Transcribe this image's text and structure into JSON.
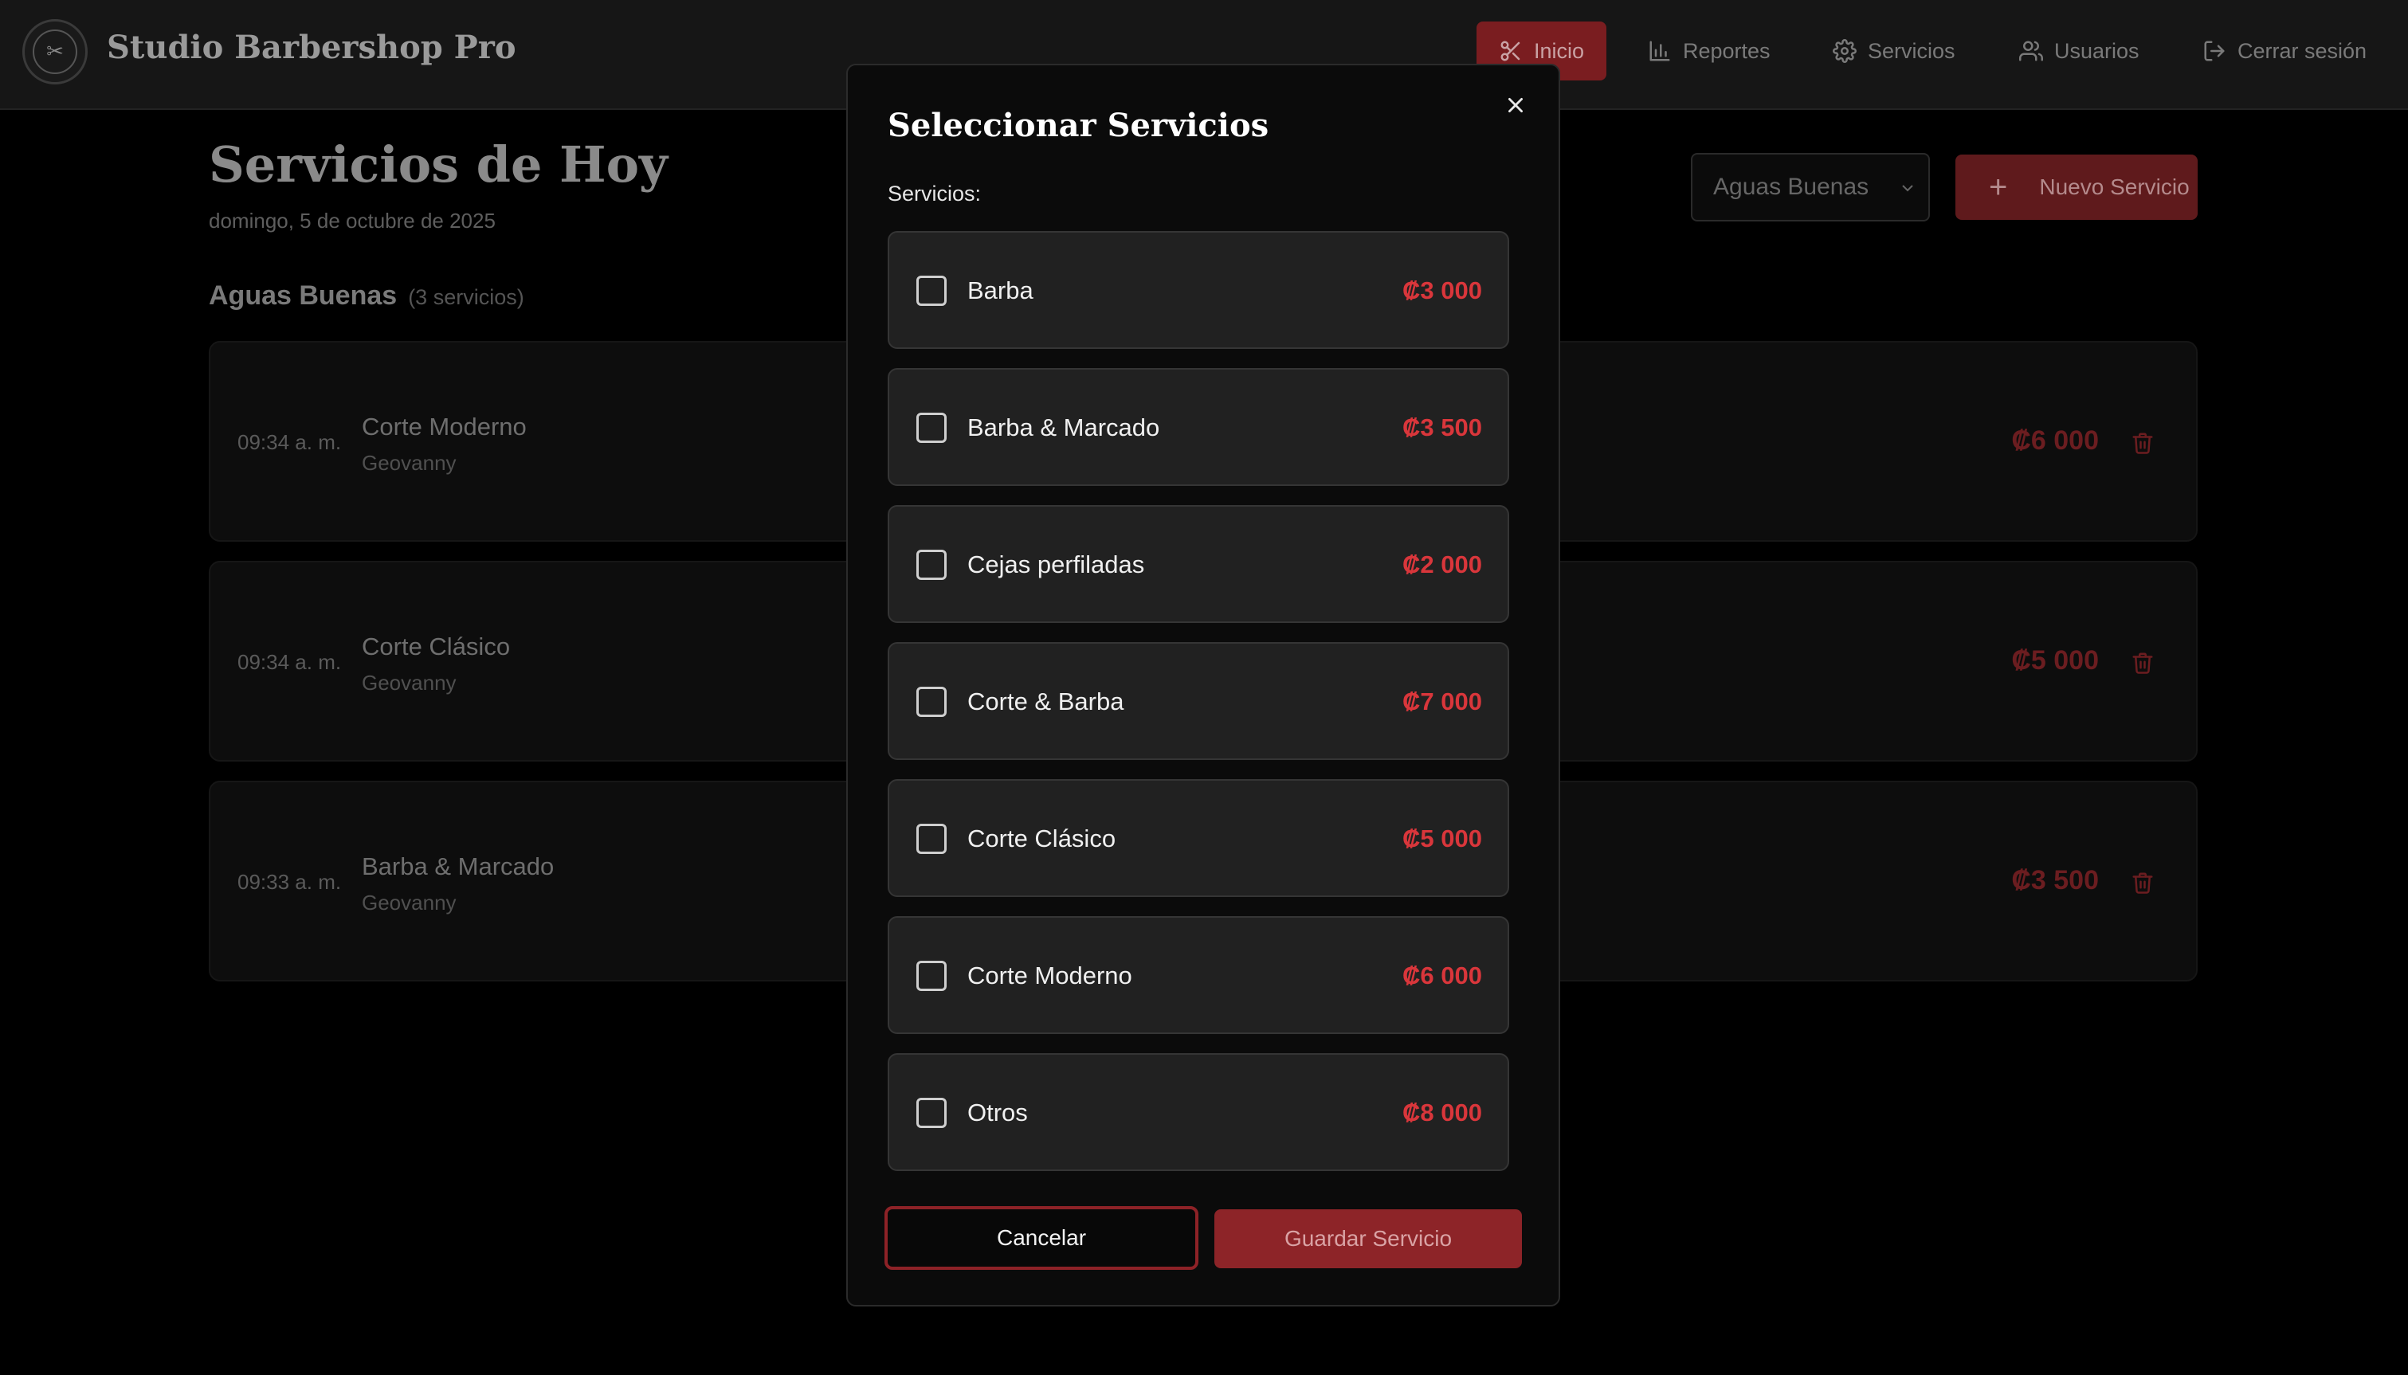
{
  "header": {
    "brand": "Studio Barbershop Pro",
    "nav": [
      {
        "label": "Inicio",
        "icon": "scissors-icon",
        "active": true
      },
      {
        "label": "Reportes",
        "icon": "bar-chart-icon"
      },
      {
        "label": "Servicios",
        "icon": "gear-icon"
      },
      {
        "label": "Usuarios",
        "icon": "users-icon"
      },
      {
        "label": "Cerrar sesión",
        "icon": "logout-icon"
      }
    ]
  },
  "main": {
    "title": "Servicios de Hoy",
    "date": "domingo, 5 de octubre de 2025",
    "branch_selected": "Aguas Buenas",
    "new_button": "Nuevo Servicio",
    "section_title": "Aguas Buenas",
    "section_count": "(3 servicios)",
    "services": [
      {
        "time": "09:34 a. m.",
        "name": "Corte Moderno",
        "barber": "Geovanny",
        "price": "₡6 000"
      },
      {
        "time": "09:34 a. m.",
        "name": "Corte Clásico",
        "barber": "Geovanny",
        "price": "₡5 000"
      },
      {
        "time": "09:33 a. m.",
        "name": "Barba & Marcado",
        "barber": "Geovanny",
        "price": "₡3 500"
      }
    ]
  },
  "modal": {
    "title": "Seleccionar Servicios",
    "label": "Servicios:",
    "options": [
      {
        "name": "Barba",
        "price": "₡3 000",
        "checked": false
      },
      {
        "name": "Barba & Marcado",
        "price": "₡3 500",
        "checked": false
      },
      {
        "name": "Cejas perfiladas",
        "price": "₡2 000",
        "checked": false
      },
      {
        "name": "Corte & Barba",
        "price": "₡7 000",
        "checked": false
      },
      {
        "name": "Corte Clásico",
        "price": "₡5 000",
        "checked": false
      },
      {
        "name": "Corte Moderno",
        "price": "₡6 000",
        "checked": false
      },
      {
        "name": "Otros",
        "price": "₡8 000",
        "checked": false
      }
    ],
    "cancel_label": "Cancelar",
    "save_label": "Guardar Servicio"
  },
  "colors": {
    "accent": "#d9363b",
    "accent_dark": "#8d2428",
    "background": "#000000",
    "card": "#212121"
  }
}
